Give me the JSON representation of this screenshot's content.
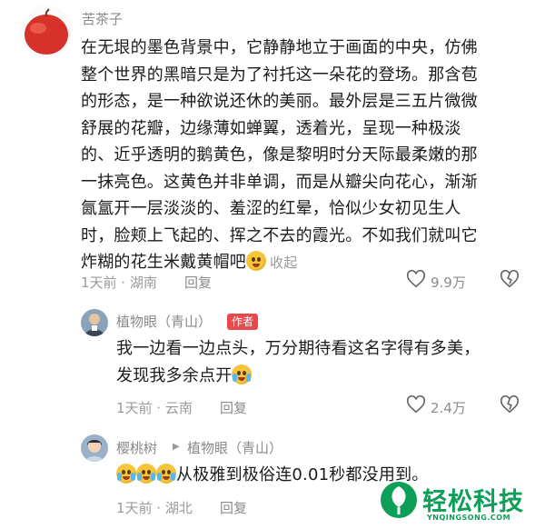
{
  "comment": {
    "username": "苦茶子",
    "lines": [
      "在无垠的墨色背景中，它静静地立于画面的中央，仿佛",
      "整个世界的黑暗只是为了衬托这一朵花的登场。那含苞",
      "的形态，是一种欲说还休的美丽。最外层是三五片微微",
      "舒展的花瓣，边缘薄如蝉翼，透着光，呈现一种极淡",
      "的、近乎透明的鹅黄色，像是黎明时分天际最柔嫩的那",
      "一抹亮色。这黄色并非单调，而是从瓣尖向花心，渐渐",
      "氤氲开一层淡淡的、羞涩的红晕，恰似少女初见生人",
      "时，脸颊上飞起的、挥之不去的霞光。不如我们就叫它",
      "炸糊的花生米戴黄帽吧"
    ],
    "collapse_label": "收起",
    "meta": "1天前 · 湖南",
    "reply_label": "回复",
    "like_count": "9.9万"
  },
  "reply1": {
    "username": "植物眼（青山）",
    "badge": "作者",
    "lines": [
      "我一边看一边点头，万分期待看这名字得有多美，",
      "发现我多余点开"
    ],
    "meta": "1天前 · 云南",
    "reply_label": "回复",
    "like_count": "2.4万"
  },
  "reply2": {
    "username": "樱桃树",
    "reply_to": "植物眼（青山）",
    "text": "从极雅到极俗连0.01秒都没用到。",
    "meta": "1天前 · 湖北",
    "reply_label": "回复"
  },
  "watermark": {
    "title": "轻松科技",
    "subtitle": "YNQINGSONG.COM"
  }
}
